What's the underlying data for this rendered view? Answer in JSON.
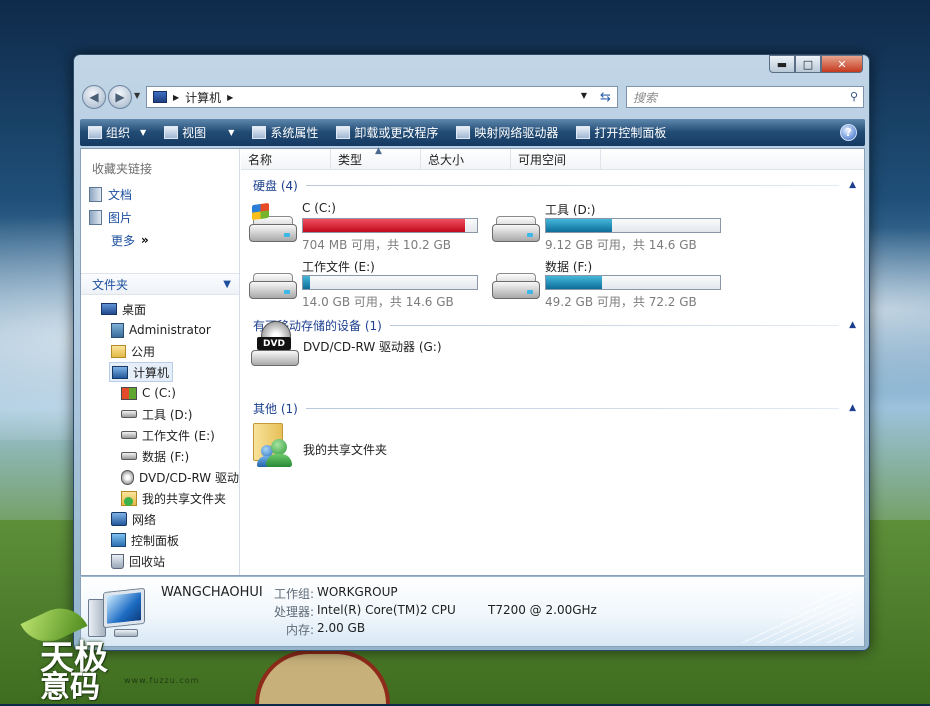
{
  "window": {
    "caption": {
      "minimize": "▬",
      "maximize": "□",
      "close": "✕"
    }
  },
  "address": {
    "path": [
      "计算机"
    ],
    "search_placeholder": "搜索"
  },
  "toolbar": {
    "items": [
      "组织",
      "视图",
      "系统属性",
      "卸载或更改程序",
      "映射网络驱动器",
      "打开控制面板"
    ],
    "help": "?"
  },
  "nav": {
    "favorites_title": "收藏夹链接",
    "favorites": [
      "文档",
      "图片",
      "更多"
    ],
    "more_arrow": "»",
    "folders_title": "文件夹",
    "tree": [
      "桌面",
      "Administrator",
      "公用",
      "计算机",
      "C (C:)",
      "工具 (D:)",
      "工作文件 (E:)",
      "数据 (F:)",
      "DVD/CD-RW 驱动",
      "我的共享文件夹",
      "网络",
      "控制面板",
      "回收站"
    ]
  },
  "columns": [
    "名称",
    "类型",
    "总大小",
    "可用空间"
  ],
  "groups": {
    "hard_disks": "硬盘 (4)",
    "removable": "有可移动存储的设备 (1)",
    "other": "其他 (1)"
  },
  "drives": [
    {
      "name": "C (C:)",
      "free": "704 MB 可用，共 10.2 GB",
      "used_fraction": 0.93,
      "bar_color": "#c20a1d"
    },
    {
      "name": "工具 (D:)",
      "free": "9.12 GB 可用，共 14.6 GB",
      "used_fraction": 0.38,
      "bar_color": "#0d6e9a"
    },
    {
      "name": "工作文件 (E:)",
      "free": "14.0 GB 可用，共 14.6 GB",
      "used_fraction": 0.04,
      "bar_color": "#0d6e9a"
    },
    {
      "name": "数据 (F:)",
      "free": "49.2 GB 可用，共 72.2 GB",
      "used_fraction": 0.32,
      "bar_color": "#0d6e9a"
    }
  ],
  "dvd": {
    "name": "DVD/CD-RW 驱动器 (G:)",
    "badge": "DVD"
  },
  "share": {
    "name": "我的共享文件夹"
  },
  "details": {
    "computer_name": "WANGCHAOHUI",
    "workgroup_label": "工作组:",
    "workgroup": "WORKGROUP",
    "cpu_label": "处理器:",
    "cpu": "Intel(R) Core(TM)2 CPU",
    "cpu_model": "T7200  @ 2.00GHz",
    "ram_label": "内存:",
    "ram": "2.00 GB"
  },
  "watermark": {
    "line1": "天极",
    "line2": "意码",
    "url": "www.fuzzu.com"
  }
}
